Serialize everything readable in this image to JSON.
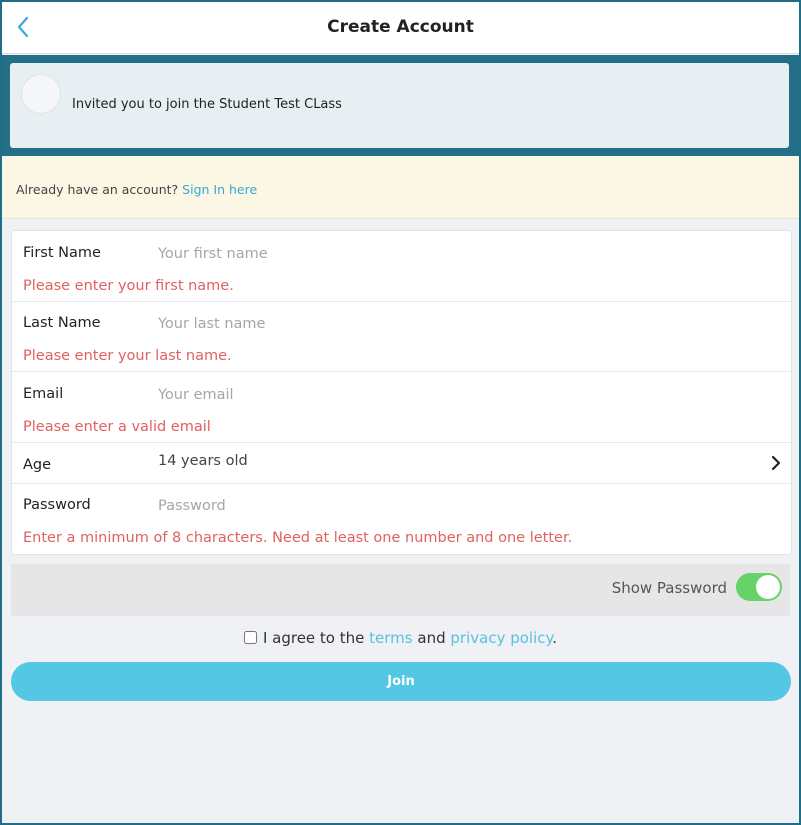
{
  "header": {
    "title": "Create Account"
  },
  "invite": {
    "text": "Invited you to join the Student Test CLass"
  },
  "signin": {
    "prompt": "Already have an account?",
    "link": "Sign In here"
  },
  "form": {
    "first_name": {
      "label": "First Name",
      "placeholder": "Your first name",
      "error": "Please enter your first name."
    },
    "last_name": {
      "label": "Last Name",
      "placeholder": "Your last name",
      "error": "Please enter your last name."
    },
    "email": {
      "label": "Email",
      "placeholder": "Your email",
      "error": "Please enter a valid email"
    },
    "age": {
      "label": "Age",
      "value": "14 years old"
    },
    "password": {
      "label": "Password",
      "placeholder": "Password",
      "error": "Enter a minimum of 8 characters. Need at least one number and one letter."
    }
  },
  "show_password": {
    "label": "Show Password",
    "enabled": true
  },
  "agree": {
    "prefix": "I agree to the",
    "terms": "terms",
    "and": "and",
    "privacy": "privacy policy",
    "suffix": "."
  },
  "join": {
    "label": "Join"
  },
  "colors": {
    "accent": "#53c7e4",
    "error": "#e0615f",
    "toggle_on": "#67d267",
    "link": "#35a9d6",
    "frame": "#236f87"
  }
}
